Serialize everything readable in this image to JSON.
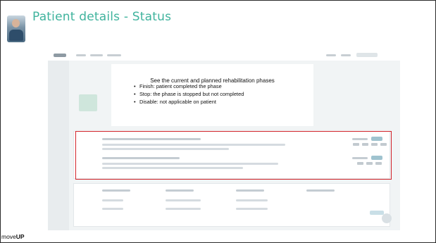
{
  "slide": {
    "title": "Patient details - Status"
  },
  "callout": {
    "heading": "See the current and planned rehabilitation phases",
    "bullets": [
      "Finish: patient completed the phase",
      "Stop: the phase is stopped but not completed",
      "Disable: not applicable on patient"
    ]
  },
  "brand": {
    "prefix": "move",
    "suffix": "UP"
  },
  "colors": {
    "title": "#3fb39d",
    "highlight": "#d2232a"
  }
}
